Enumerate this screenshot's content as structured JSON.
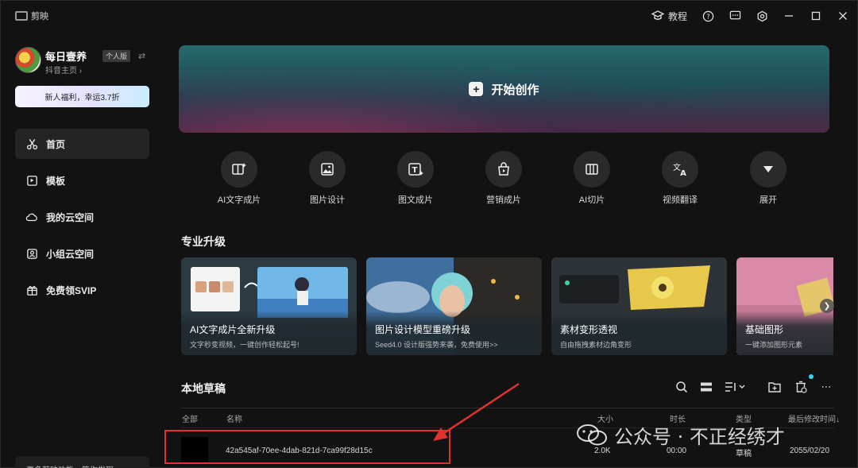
{
  "app": {
    "logo_text": "剪映",
    "tutorial_label": "教程",
    "icons": [
      "help-icon",
      "feedback-icon",
      "settings-icon",
      "minimize-icon",
      "maximize-icon",
      "close-icon"
    ]
  },
  "profile": {
    "name": "每日壹养",
    "badge": "个人版",
    "sub": "抖音主页 ›"
  },
  "promo": {
    "label": "新人福利，幸运3.7折"
  },
  "nav": [
    {
      "label": "首页",
      "icon": "scissors-icon",
      "active": true
    },
    {
      "label": "模板",
      "icon": "template-icon"
    },
    {
      "label": "我的云空间",
      "icon": "cloud-icon"
    },
    {
      "label": "小组云空间",
      "icon": "group-cloud-icon"
    },
    {
      "label": "免费领SVIP",
      "icon": "gift-icon"
    }
  ],
  "sidebar_bottom": {
    "label": "更多剪映功能，等你发现"
  },
  "hero": {
    "label": "开始创作"
  },
  "tools": [
    {
      "label": "AI文字成片",
      "icon": "ai-text-icon"
    },
    {
      "label": "图片设计",
      "icon": "image-design-icon"
    },
    {
      "label": "图文成片",
      "icon": "text-image-icon"
    },
    {
      "label": "营销成片",
      "icon": "marketing-icon"
    },
    {
      "label": "AI切片",
      "icon": "ai-slice-icon"
    },
    {
      "label": "视频翻译",
      "icon": "translate-icon"
    },
    {
      "label": "展开",
      "icon": "expand-icon"
    }
  ],
  "pro_section": {
    "title": "专业升级"
  },
  "cards": [
    {
      "title": "AI文字成片全新升级",
      "sub": "文字秒变视频，一键创作轻松起号!"
    },
    {
      "title": "图片设计模型重磅升级",
      "sub": "Seed4.0 设计版强势来袭，免费使用>>"
    },
    {
      "title": "素材变形透视",
      "sub": "自由拖拽素材边角变形"
    },
    {
      "title": "基础图形",
      "sub": "一键添加图形元素"
    }
  ],
  "drafts": {
    "title": "本地草稿",
    "columns": {
      "all": "全部",
      "name": "名称",
      "size": "大小",
      "duration": "时长",
      "type": "类型",
      "modified": "最后修改时间↓"
    },
    "rows": [
      {
        "name": "42a545af-70ee-4dab-821d-7ca99f28d15c",
        "size": "2.0K",
        "duration": "00:00",
        "type": "草稿",
        "modified": "2055/02/20"
      }
    ]
  },
  "watermark": {
    "text": "公众号 · 不正经绣才"
  }
}
